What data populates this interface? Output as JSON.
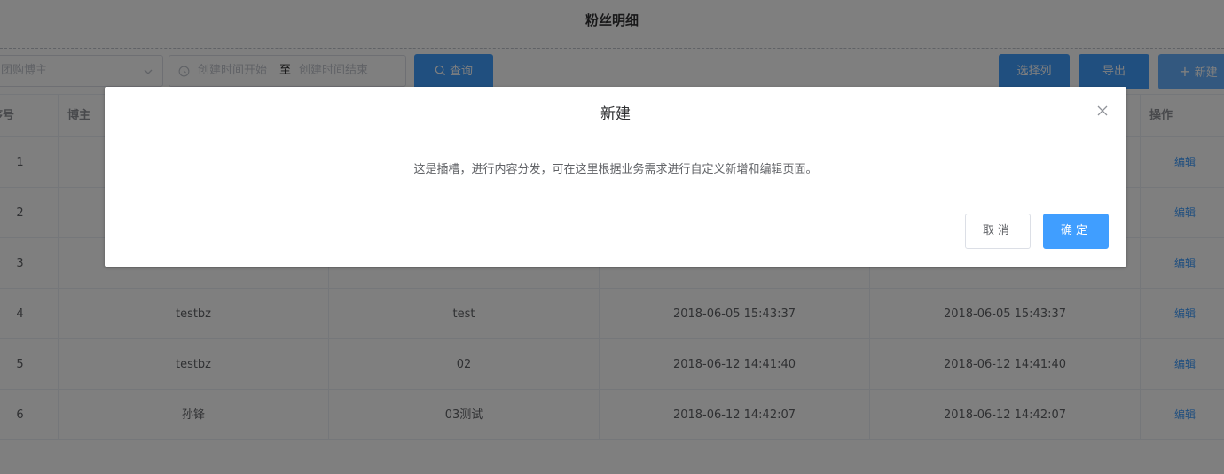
{
  "page": {
    "title": "粉丝明细"
  },
  "filters": {
    "blogger_placeholder": "团购博主",
    "date_start_placeholder": "创建时间开始",
    "date_separator": "至",
    "date_end_placeholder": "创建时间结束"
  },
  "toolbar": {
    "search_label": "查询",
    "select_columns_label": "选择列",
    "export_label": "导出",
    "new_label": "新建"
  },
  "table": {
    "headers": [
      "序号",
      "博主",
      "",
      "",
      "",
      "操作"
    ],
    "rows": [
      {
        "index": "1",
        "blogger": "",
        "name": "",
        "created": "",
        "updated": "",
        "action": "编辑"
      },
      {
        "index": "2",
        "blogger": "",
        "name": "",
        "created": "",
        "updated": "",
        "action": "编辑"
      },
      {
        "index": "3",
        "blogger": "",
        "name": "",
        "created": "",
        "updated": "",
        "action": "编辑"
      },
      {
        "index": "4",
        "blogger": "testbz",
        "name": "test",
        "created": "2018-06-05 15:43:37",
        "updated": "2018-06-05 15:43:37",
        "action": "编辑"
      },
      {
        "index": "5",
        "blogger": "testbz",
        "name": "02",
        "created": "2018-06-12 14:41:40",
        "updated": "2018-06-12 14:41:40",
        "action": "编辑"
      },
      {
        "index": "6",
        "blogger": "孙锋",
        "name": "03测试",
        "created": "2018-06-12 14:42:07",
        "updated": "2018-06-12 14:42:07",
        "action": "编辑"
      }
    ]
  },
  "dialog": {
    "title": "新建",
    "body": "这是插槽，进行内容分发，可在这里根据业务需求进行自定义新增和编辑页面。",
    "cancel_label": "取消",
    "confirm_label": "确定"
  },
  "colors": {
    "primary": "#409eff",
    "mask": "rgba(0,0,0,0.5)",
    "link": "#409eff"
  },
  "icons": [
    "chevron-down-icon",
    "clock-icon",
    "search-icon",
    "plus-icon",
    "close-icon"
  ]
}
